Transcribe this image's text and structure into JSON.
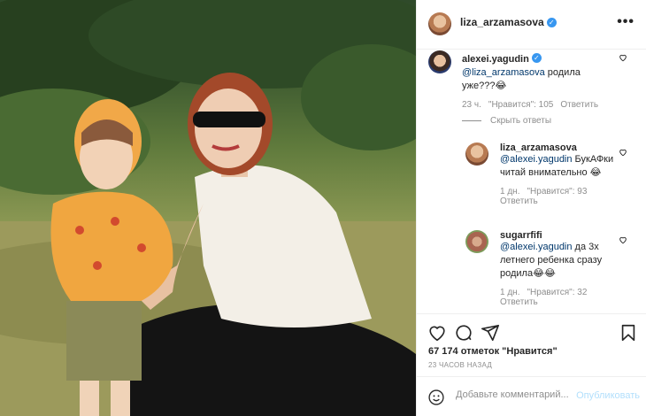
{
  "post": {
    "author": "liza_arzamasova",
    "verified_glyph": "✓",
    "more_glyph": "•••"
  },
  "comments": [
    {
      "user": "alexei.yagudin",
      "verified_glyph": "✓",
      "mention": "@liza_arzamasova",
      "text": " родила уже???😂",
      "time": "23 ч.",
      "likes": "\"Нравится\": 105",
      "reply": "Ответить"
    }
  ],
  "hide_replies": "Скрыть ответы",
  "replies": [
    {
      "user": "liza_arzamasova",
      "mention": "@alexei.yagudin",
      "text": " БукАФки читай внимательно 😂",
      "time": "1 дн.",
      "likes": "\"Нравится\": 93",
      "reply": "Ответить"
    },
    {
      "user": "sugarrfifi",
      "mention": "@alexei.yagudin",
      "text": " да 3х летнего ребенка сразу родила😂😂",
      "time": "1 дн.",
      "likes": "\"Нравится\": 32",
      "reply": "Ответить"
    }
  ],
  "footer": {
    "likes": "67 174 отметок \"Нравится\"",
    "time": "23 ЧАСОВ НАЗАД",
    "comment_placeholder": "Добавьте комментарий...",
    "publish": "Опубликовать"
  },
  "icons": [
    "heart-icon",
    "comment-icon",
    "share-icon",
    "bookmark-icon",
    "smiley-icon"
  ],
  "colors": {
    "link": "#00376b",
    "publish": "#b2dffc",
    "verified": "#3897f0"
  }
}
